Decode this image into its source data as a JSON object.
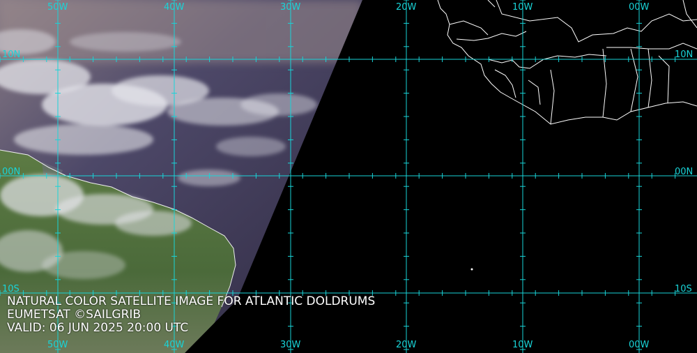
{
  "caption": {
    "title": "NATURAL COLOR SATELLITE IMAGE FOR ATLANTIC DOLDRUMS",
    "credit": "EUMETSAT ©SAILGRIB",
    "valid": "VALID:  06 JUN 2025 20:00 UTC"
  },
  "grid": {
    "lon_labels": [
      "50W",
      "40W",
      "30W",
      "20W",
      "10W",
      "00W"
    ],
    "lat_labels": [
      "10N",
      "00N",
      "10S"
    ]
  },
  "colors": {
    "grid_line": "#19d4d8",
    "coastline": "#ffffff",
    "night_side": "#000000",
    "ocean_day": "#3e3a5c",
    "land_day": "#4e6a3c",
    "cloud": "#e6e6ea"
  }
}
